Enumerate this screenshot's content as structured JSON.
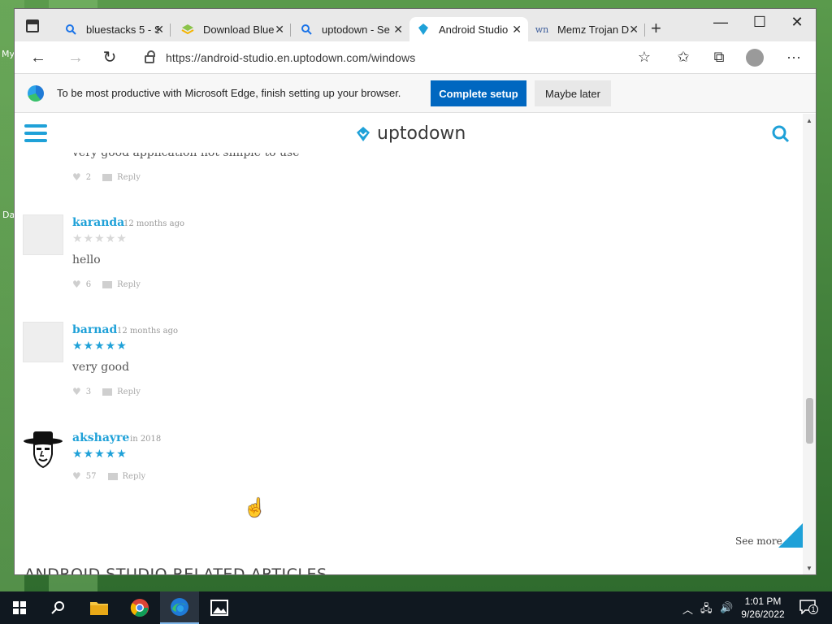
{
  "desktop": {
    "label_top": "My",
    "label_bottom": "Da"
  },
  "browser": {
    "tabs": [
      {
        "title": "bluestacks 5 - S",
        "icon": "search-icon"
      },
      {
        "title": "Download Blue",
        "icon": "bluestacks-icon"
      },
      {
        "title": "uptodown - Se",
        "icon": "search-icon"
      },
      {
        "title": "Android Studio",
        "icon": "uptodown-icon",
        "active": true
      },
      {
        "title": "Memz Trojan D",
        "icon": "wn-icon"
      }
    ],
    "address": {
      "url": "https://android-studio.en.uptodown.com/windows"
    },
    "infobar": {
      "message": "To be most productive with Microsoft Edge, finish setting up your browser.",
      "complete_label": "Complete setup",
      "later_label": "Maybe later"
    }
  },
  "site": {
    "logo_text": "uptodown",
    "partial_comment": {
      "text": "very good application not simple to use",
      "likes": "2",
      "reply_label": "Reply"
    },
    "comments": [
      {
        "name": "karanda",
        "time": "12 months ago",
        "rating": 0,
        "text": "hello",
        "likes": "6",
        "reply_label": "Reply"
      },
      {
        "name": "barnad",
        "time": "12 months ago",
        "rating": 5,
        "text": "very good",
        "likes": "3",
        "reply_label": "Reply"
      },
      {
        "name": "akshayre",
        "time": "in 2018",
        "rating": 5,
        "text": "",
        "likes": "57",
        "reply_label": "Reply"
      }
    ],
    "see_more_label": "See more",
    "related_heading": "ANDROID STUDIO RELATED ARTICLES",
    "accent_color": "#1fa1d8"
  },
  "taskbar": {
    "time": "1:01 PM",
    "date": "9/26/2022",
    "notification_count": "1",
    "apps": [
      "start-icon",
      "search-icon",
      "file-explorer-icon",
      "chrome-icon",
      "edge-icon",
      "photos-icon"
    ]
  }
}
